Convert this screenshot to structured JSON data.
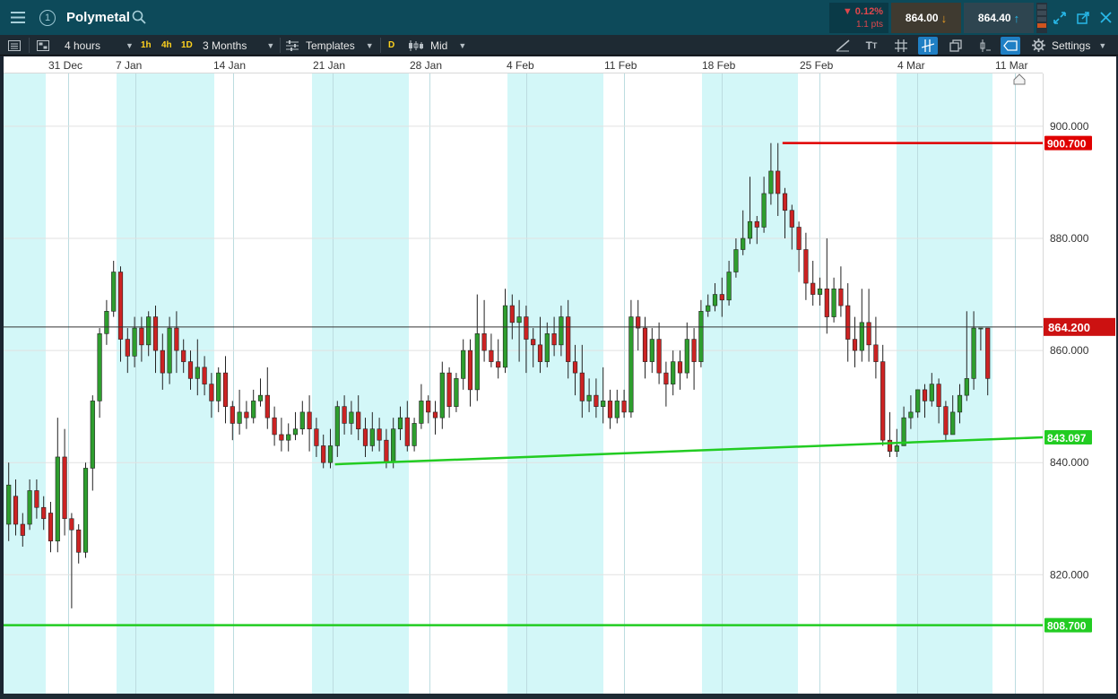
{
  "header": {
    "title": "Polymetal",
    "change_pct": "▼ 0.12%",
    "change_pts": "1.1 pts",
    "sell_price": "864.00",
    "buy_price": "864.40",
    "menu_icon": "hamburger-icon",
    "info_icon_label": "1",
    "search_icon": "search-icon",
    "sell_arrow": "↓",
    "buy_arrow": "↑"
  },
  "toolbar": {
    "interval": "4 hours",
    "quick_1h": "1h",
    "quick_4h": "4h",
    "quick_1d": "1D",
    "range": "3 Months",
    "templates": "Templates",
    "d_badge": "D",
    "price_type": "Mid",
    "settings": "Settings"
  },
  "colors": {
    "up": "#2e9e2e",
    "down": "#cc2323",
    "shade": "#d3f7f8",
    "green_line": "#22cc22",
    "red_line": "#e00000",
    "current_price": "#cc1111"
  },
  "chart_data": {
    "type": "candlestick",
    "instrument": "Polymetal",
    "interval": "4 hours",
    "range": "3 Months",
    "x_ticks": [
      "31 Dec",
      "7 Jan",
      "14 Jan",
      "21 Jan",
      "28 Jan",
      "4 Feb",
      "11 Feb",
      "18 Feb",
      "25 Feb",
      "4 Mar",
      "11 Mar"
    ],
    "y_ticks": [
      "900.000",
      "880.000",
      "860.000",
      "840.000",
      "820.000"
    ],
    "ylim": [
      803,
      920
    ],
    "current_price": 864.2,
    "current_price_label": "864.200",
    "levels": [
      {
        "label": "900.700",
        "value": 897.0,
        "type": "resistance",
        "color": "red"
      },
      {
        "label": "808.700",
        "value": 811.0,
        "type": "support",
        "color": "green"
      }
    ],
    "trendlines": [
      {
        "label": "843.097",
        "start": [
          11.7,
          839.7
        ],
        "end": [
          38.5,
          844.5
        ],
        "color": "green"
      }
    ],
    "candles": [
      [
        829,
        836,
        826,
        840
      ],
      [
        834,
        829,
        827,
        837
      ],
      [
        829,
        827,
        825,
        831
      ],
      [
        829,
        835,
        828,
        837
      ],
      [
        835,
        832,
        830,
        837
      ],
      [
        832,
        830,
        828,
        834
      ],
      [
        831,
        826,
        824,
        833
      ],
      [
        826,
        841,
        824,
        848
      ],
      [
        841,
        830,
        827,
        846
      ],
      [
        830,
        828,
        814,
        831
      ],
      [
        828,
        824,
        822,
        829
      ],
      [
        824,
        839,
        823,
        840
      ],
      [
        839,
        851,
        835,
        852
      ],
      [
        851,
        863,
        848,
        864
      ],
      [
        863,
        867,
        861,
        869
      ],
      [
        867,
        874,
        866,
        876
      ],
      [
        874,
        862,
        858,
        875
      ],
      [
        862,
        859,
        856,
        864
      ],
      [
        859,
        864,
        857,
        866
      ],
      [
        864,
        861,
        858,
        866
      ],
      [
        861,
        866,
        859,
        867
      ],
      [
        866,
        860,
        856,
        868
      ],
      [
        860,
        856,
        853,
        863
      ],
      [
        856,
        864,
        854,
        866
      ],
      [
        864,
        860,
        856,
        867
      ],
      [
        860,
        858,
        856,
        862
      ],
      [
        858,
        855,
        853,
        860
      ],
      [
        855,
        857,
        852,
        862
      ],
      [
        857,
        854,
        852,
        859
      ],
      [
        854,
        851,
        848,
        856
      ],
      [
        851,
        856,
        849,
        857
      ],
      [
        856,
        850,
        847,
        859
      ],
      [
        850,
        847,
        844,
        851
      ],
      [
        847,
        849,
        845,
        853
      ],
      [
        849,
        848,
        846,
        851
      ],
      [
        848,
        851,
        847,
        853
      ],
      [
        851,
        852,
        850,
        855
      ],
      [
        852,
        848,
        846,
        857
      ],
      [
        848,
        845,
        843,
        850
      ],
      [
        845,
        844,
        842,
        848
      ],
      [
        844,
        845,
        842,
        847
      ],
      [
        845,
        846,
        844,
        849
      ],
      [
        846,
        849,
        845,
        851
      ],
      [
        849,
        846,
        842,
        852
      ],
      [
        846,
        843,
        841,
        848
      ],
      [
        843,
        840,
        839,
        845
      ],
      [
        840,
        843,
        839,
        846
      ],
      [
        843,
        850,
        841,
        851
      ],
      [
        850,
        847,
        845,
        852
      ],
      [
        847,
        849,
        845,
        851
      ],
      [
        849,
        846,
        844,
        852
      ],
      [
        846,
        843,
        841,
        848
      ],
      [
        843,
        846,
        842,
        849
      ],
      [
        846,
        844,
        842,
        848
      ],
      [
        844,
        840,
        839,
        846
      ],
      [
        840,
        846,
        839,
        848
      ],
      [
        846,
        848,
        844,
        850
      ],
      [
        848,
        843,
        842,
        851
      ],
      [
        843,
        847,
        842,
        848
      ],
      [
        847,
        851,
        846,
        854
      ],
      [
        851,
        849,
        847,
        852
      ],
      [
        849,
        848,
        845,
        851
      ],
      [
        848,
        856,
        846,
        858
      ],
      [
        856,
        850,
        848,
        857
      ],
      [
        850,
        855,
        849,
        856
      ],
      [
        855,
        860,
        853,
        862
      ],
      [
        860,
        853,
        850,
        862
      ],
      [
        853,
        863,
        851,
        870
      ],
      [
        863,
        860,
        858,
        869
      ],
      [
        860,
        858,
        857,
        863
      ],
      [
        858,
        857,
        855,
        862
      ],
      [
        857,
        868,
        856,
        871
      ],
      [
        868,
        865,
        862,
        870
      ],
      [
        865,
        866,
        858,
        869
      ],
      [
        866,
        862,
        856,
        868
      ],
      [
        862,
        861,
        857,
        864
      ],
      [
        861,
        858,
        856,
        866
      ],
      [
        858,
        863,
        857,
        865
      ],
      [
        863,
        861,
        859,
        866
      ],
      [
        861,
        866,
        859,
        868
      ],
      [
        866,
        858,
        855,
        869
      ],
      [
        858,
        856,
        852,
        861
      ],
      [
        856,
        851,
        848,
        861
      ],
      [
        851,
        852,
        849,
        855
      ],
      [
        852,
        850,
        848,
        855
      ],
      [
        850,
        851,
        847,
        857
      ],
      [
        851,
        848,
        846,
        853
      ],
      [
        848,
        851,
        847,
        853
      ],
      [
        851,
        849,
        848,
        853
      ],
      [
        849,
        866,
        848,
        869
      ],
      [
        866,
        864,
        860,
        869
      ],
      [
        864,
        858,
        855,
        866
      ],
      [
        858,
        862,
        856,
        864
      ],
      [
        862,
        856,
        854,
        865
      ],
      [
        856,
        854,
        850,
        858
      ],
      [
        854,
        858,
        852,
        860
      ],
      [
        858,
        856,
        853,
        860
      ],
      [
        856,
        862,
        855,
        865
      ],
      [
        862,
        858,
        853,
        864
      ],
      [
        858,
        867,
        857,
        869
      ],
      [
        867,
        868,
        866,
        870
      ],
      [
        868,
        870,
        867,
        872
      ],
      [
        870,
        869,
        866,
        873
      ],
      [
        869,
        874,
        868,
        876
      ],
      [
        874,
        878,
        873,
        880
      ],
      [
        878,
        880,
        877,
        885
      ],
      [
        880,
        883,
        879,
        891
      ],
      [
        883,
        882,
        879,
        884
      ],
      [
        882,
        888,
        881,
        891
      ],
      [
        888,
        892,
        886,
        897
      ],
      [
        892,
        888,
        884,
        897
      ],
      [
        888,
        885,
        880,
        889
      ],
      [
        885,
        882,
        878,
        886
      ],
      [
        882,
        878,
        874,
        883
      ],
      [
        878,
        872,
        869,
        881
      ],
      [
        872,
        870,
        868,
        876
      ],
      [
        870,
        871,
        868,
        873
      ],
      [
        871,
        866,
        863,
        880
      ],
      [
        866,
        871,
        865,
        873
      ],
      [
        871,
        868,
        866,
        875
      ],
      [
        868,
        862,
        858,
        872
      ],
      [
        862,
        860,
        857,
        866
      ],
      [
        860,
        865,
        858,
        871
      ],
      [
        865,
        861,
        858,
        871
      ],
      [
        861,
        858,
        855,
        866
      ],
      [
        858,
        844,
        843,
        861
      ],
      [
        844,
        842,
        841,
        849
      ],
      [
        842,
        843,
        841,
        846
      ],
      [
        843,
        848,
        843,
        850
      ],
      [
        848,
        849,
        846,
        852
      ],
      [
        849,
        853,
        848,
        853
      ],
      [
        853,
        851,
        848,
        854
      ],
      [
        851,
        854,
        850,
        856
      ],
      [
        854,
        850,
        847,
        855
      ],
      [
        850,
        845,
        844,
        851
      ],
      [
        845,
        849,
        845,
        852
      ],
      [
        849,
        852,
        847,
        854
      ],
      [
        852,
        855,
        851,
        867
      ],
      [
        855,
        864,
        853,
        867
      ],
      [
        864,
        864,
        860,
        864
      ],
      [
        864,
        855,
        852,
        864
      ]
    ]
  }
}
